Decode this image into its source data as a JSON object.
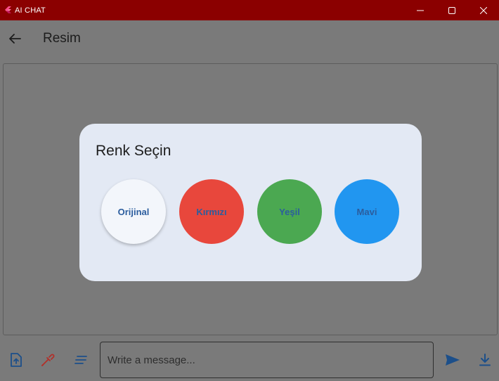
{
  "window": {
    "title": "AI CHAT"
  },
  "appbar": {
    "title": "Resim"
  },
  "dialog": {
    "title": "Renk Seçin",
    "options": [
      {
        "label": "Orijinal",
        "color": "#f3f6fb"
      },
      {
        "label": "Kırmızı",
        "color": "#e8473c"
      },
      {
        "label": "Yeşil",
        "color": "#4ba851"
      },
      {
        "label": "Mavi",
        "color": "#2196f0"
      }
    ]
  },
  "composer": {
    "placeholder": "Write a message..."
  },
  "icons": {
    "app_logo": "flutter-logo-icon",
    "minimize": "minimize-icon",
    "maximize": "maximize-icon",
    "close": "close-icon",
    "back": "arrow-back-icon",
    "attach": "file-upload-icon",
    "color_picker": "eyedropper-icon",
    "notes": "short-text-icon",
    "send": "send-icon",
    "download": "download-icon"
  },
  "colors": {
    "titlebar": "#8b0000",
    "overlay": "#7a7a7a",
    "dialog_bg": "#e3e9f4",
    "label_text": "#2b5d9e",
    "tool_icon": "#1c4f8a",
    "eyedropper": "#b2302a"
  }
}
